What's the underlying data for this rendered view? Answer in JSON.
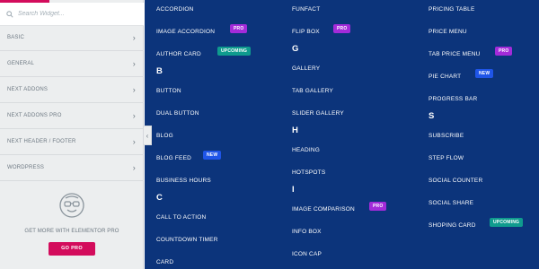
{
  "sidebar": {
    "search_placeholder": "Search Widget...",
    "categories": [
      "BASIC",
      "GENERAL",
      "NEXT ADDONS",
      "NEXT ADDONS PRO",
      "NEXT HEADER / FOOTER",
      "WORDPRESS"
    ],
    "promo_text": "GET MORE WITH ELEMENTOR PRO",
    "go_pro_label": "GO PRO"
  },
  "widgets": {
    "accordion": "ACCORDION",
    "image_accordion": "IMAGE ACCORDION",
    "author_card": "AUTHOR CARD",
    "letter_b": "B",
    "button": "BUTTON",
    "dual_button": "DUAL BUTTON",
    "blog": "BLOG",
    "blog_feed": "BLOG FEED",
    "business_hours": "BUSINESS HOURS",
    "letter_c": "C",
    "call_to_action": "CALL TO ACTION",
    "countdown_timer": "COUNTDOWN TIMER",
    "card": "CARD",
    "funfact": "FUNFACT",
    "flip_box": "FLIP BOX",
    "letter_g": "G",
    "gallery": "GALLERY",
    "tab_gallery": "TAB GALLERY",
    "slider_gallery": "SLIDER GALLERY",
    "letter_h": "H",
    "heading": "HEADING",
    "hotspots": "HOTSPOTS",
    "letter_i": "I",
    "image_comparison": "IMAGE COMPARISON",
    "info_box": "INFO BOX",
    "icon_cap": "ICON CAP",
    "pricing_table": "PRICING TABLE",
    "price_menu": "PRICE MENU",
    "tab_price_menu": "TAB PRICE MENU",
    "pie_chart": "PIE CHART",
    "progress_bar": "PROGRESS BAR",
    "letter_s": "S",
    "subscribe": "SUBSCRIBE",
    "step_flow": "STEP FLOW",
    "social_counter": "SOCIAL COUNTER",
    "social_share": "SOCIAL SHARE",
    "shoping_card": "SHOPING CARD"
  },
  "badges": {
    "pro": "PRO",
    "new": "NEW",
    "upcoming": "UPCOMING"
  },
  "colors": {
    "accent": "#d30c5c",
    "background": "#0c347b",
    "pro": "#a32bd9",
    "new": "#1f55e8",
    "upcoming": "#0f9b8e"
  }
}
